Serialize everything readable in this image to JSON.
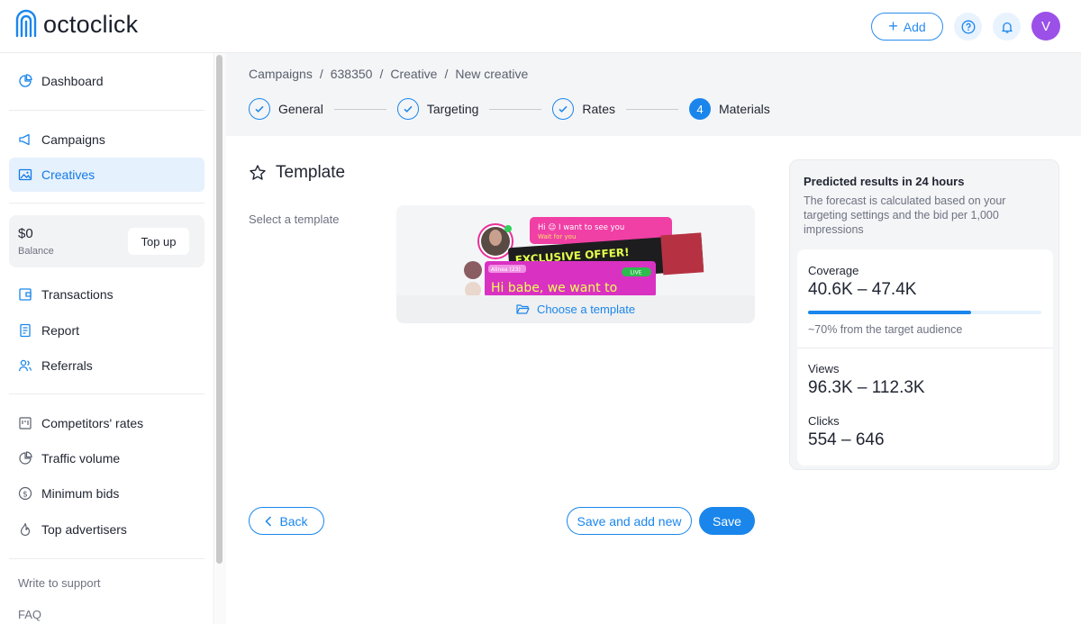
{
  "app": {
    "logo_text": "octoclick"
  },
  "header": {
    "add_label": "Add",
    "avatar_initial": "V"
  },
  "sidebar": {
    "items": [
      {
        "label": "Dashboard",
        "icon": "pie-chart-icon"
      },
      {
        "label": "Campaigns",
        "icon": "megaphone-icon"
      },
      {
        "label": "Creatives",
        "icon": "image-icon",
        "active": true
      },
      {
        "label": "Transactions",
        "icon": "wallet-icon"
      },
      {
        "label": "Report",
        "icon": "report-icon"
      },
      {
        "label": "Referrals",
        "icon": "referrals-icon"
      },
      {
        "label": "Competitors' rates",
        "icon": "bar-chart-icon"
      },
      {
        "label": "Traffic volume",
        "icon": "pie-chart-icon"
      },
      {
        "label": "Minimum bids",
        "icon": "dollar-circle-icon"
      },
      {
        "label": "Top advertisers",
        "icon": "flame-icon"
      }
    ],
    "balance": {
      "amount": "$0",
      "label": "Balance",
      "topup_label": "Top up"
    },
    "links": {
      "support": "Write to support",
      "faq": "FAQ"
    }
  },
  "breadcrumb": [
    "Campaigns",
    "/",
    "638350",
    "/",
    "Creative",
    "/",
    "New creative"
  ],
  "steps": [
    {
      "label": "General",
      "state": "done"
    },
    {
      "label": "Targeting",
      "state": "done"
    },
    {
      "label": "Rates",
      "state": "done"
    },
    {
      "label": "Materials",
      "state": "current",
      "number": "4"
    }
  ],
  "template": {
    "title": "Template",
    "select_label": "Select a template",
    "choose_label": "Choose a template",
    "preview": {
      "bubble_top": "Hi 😉 I want to see you",
      "bubble_top_sub": "Wait for you",
      "offer": "EXCLUSIVE OFFER!",
      "name_tag": "Alinea (23)",
      "live": "LIVE",
      "message": "Hi babe, we want to"
    }
  },
  "prediction": {
    "title": "Predicted results in 24 hours",
    "description": "The forecast is calculated based on your targeting settings and the bid per 1,000 impressions",
    "coverage_label": "Coverage",
    "coverage_value": "40.6K – 47.4K",
    "coverage_progress": 0.7,
    "coverage_note": "~70% from the target audience",
    "views_label": "Views",
    "views_value": "96.3K – 112.3K",
    "clicks_label": "Clicks",
    "clicks_value": "554 – 646"
  },
  "actions": {
    "back": "Back",
    "save_and_add_new": "Save and add new",
    "save": "Save"
  },
  "colors": {
    "accent": "#1a86ec",
    "avatar": "#9b50e8",
    "active_bg": "#e5f1fd"
  }
}
